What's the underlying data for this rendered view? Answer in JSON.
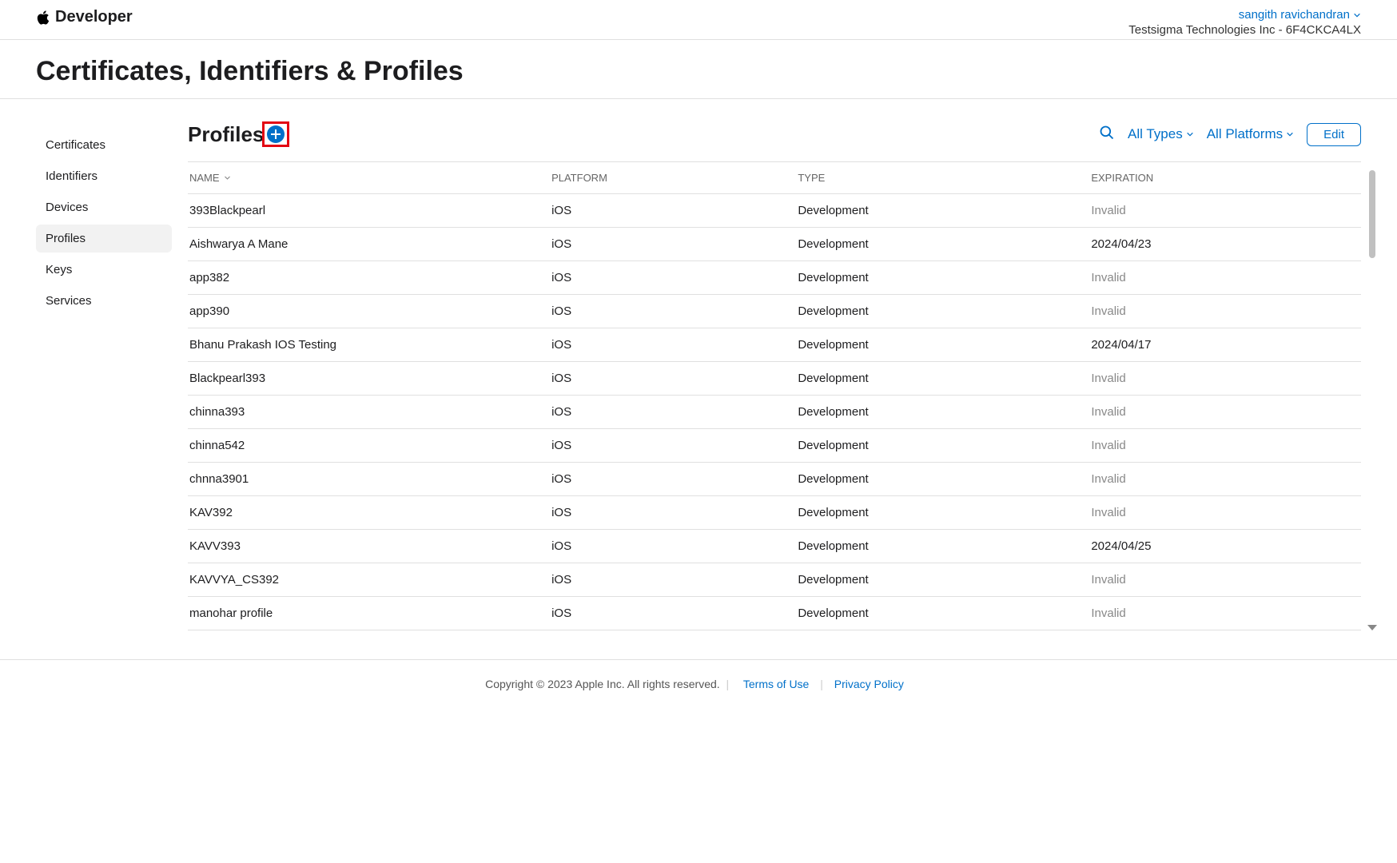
{
  "header": {
    "brand": "Developer",
    "user_name": "sangith ravichandran",
    "team_info": "Testsigma Technologies Inc - 6F4CKCA4LX"
  },
  "page": {
    "title": "Certificates, Identifiers & Profiles"
  },
  "sidebar": {
    "items": [
      {
        "label": "Certificates",
        "active": false
      },
      {
        "label": "Identifiers",
        "active": false
      },
      {
        "label": "Devices",
        "active": false
      },
      {
        "label": "Profiles",
        "active": true
      },
      {
        "label": "Keys",
        "active": false
      },
      {
        "label": "Services",
        "active": false
      }
    ]
  },
  "section": {
    "title": "Profiles",
    "filter_types": "All Types",
    "filter_platforms": "All Platforms",
    "edit_label": "Edit"
  },
  "table": {
    "columns": {
      "name": "NAME",
      "platform": "PLATFORM",
      "type": "TYPE",
      "expiration": "EXPIRATION"
    },
    "rows": [
      {
        "name": "393Blackpearl",
        "platform": "iOS",
        "type": "Development",
        "expiration": "Invalid",
        "invalid": true
      },
      {
        "name": "Aishwarya A Mane",
        "platform": "iOS",
        "type": "Development",
        "expiration": "2024/04/23",
        "invalid": false
      },
      {
        "name": "app382",
        "platform": "iOS",
        "type": "Development",
        "expiration": "Invalid",
        "invalid": true
      },
      {
        "name": "app390",
        "platform": "iOS",
        "type": "Development",
        "expiration": "Invalid",
        "invalid": true
      },
      {
        "name": "Bhanu Prakash IOS Testing",
        "platform": "iOS",
        "type": "Development",
        "expiration": "2024/04/17",
        "invalid": false
      },
      {
        "name": "Blackpearl393",
        "platform": "iOS",
        "type": "Development",
        "expiration": "Invalid",
        "invalid": true
      },
      {
        "name": "chinna393",
        "platform": "iOS",
        "type": "Development",
        "expiration": "Invalid",
        "invalid": true
      },
      {
        "name": "chinna542",
        "platform": "iOS",
        "type": "Development",
        "expiration": "Invalid",
        "invalid": true
      },
      {
        "name": "chnna3901",
        "platform": "iOS",
        "type": "Development",
        "expiration": "Invalid",
        "invalid": true
      },
      {
        "name": "KAV392",
        "platform": "iOS",
        "type": "Development",
        "expiration": "Invalid",
        "invalid": true
      },
      {
        "name": "KAVV393",
        "platform": "iOS",
        "type": "Development",
        "expiration": "2024/04/25",
        "invalid": false
      },
      {
        "name": "KAVVYA_CS392",
        "platform": "iOS",
        "type": "Development",
        "expiration": "Invalid",
        "invalid": true
      },
      {
        "name": "manohar profile",
        "platform": "iOS",
        "type": "Development",
        "expiration": "Invalid",
        "invalid": true
      }
    ]
  },
  "footer": {
    "copyright": "Copyright © 2023 Apple Inc. All rights reserved.",
    "terms": "Terms of Use",
    "privacy": "Privacy Policy"
  }
}
